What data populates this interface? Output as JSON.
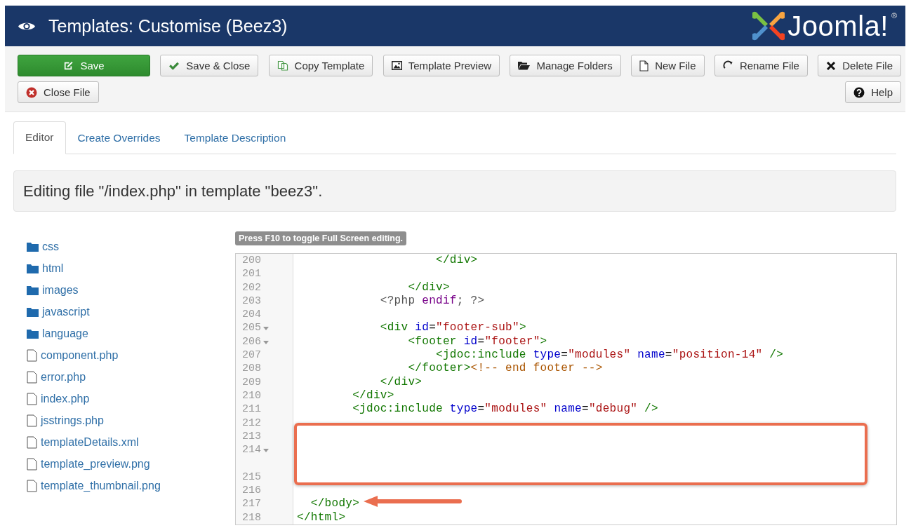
{
  "header": {
    "title": "Templates: Customise (Beez3)",
    "brand": "Joomla!",
    "brand_mark": "®"
  },
  "toolbar": {
    "buttons": [
      {
        "label": "Save",
        "kind": "save",
        "primary": true
      },
      {
        "label": "Save & Close",
        "kind": "apply",
        "primary": false
      },
      {
        "label": "Copy Template",
        "kind": "copy",
        "primary": false
      },
      {
        "label": "Template Preview",
        "kind": "preview",
        "primary": false
      },
      {
        "label": "Manage Folders",
        "kind": "folders",
        "primary": false
      },
      {
        "label": "New File",
        "kind": "new",
        "primary": false
      },
      {
        "label": "Rename File",
        "kind": "rename",
        "primary": false
      },
      {
        "label": "Delete File",
        "kind": "delete",
        "primary": false
      },
      {
        "label": "Close File",
        "kind": "close",
        "primary": false
      },
      {
        "label": "Help",
        "kind": "help",
        "primary": false
      }
    ]
  },
  "tabs": [
    {
      "label": "Editor",
      "selected": true
    },
    {
      "label": "Create Overrides",
      "selected": false
    },
    {
      "label": "Template Description",
      "selected": false
    }
  ],
  "editing_heading": "Editing file \"/index.php\" in template \"beez3\".",
  "files": [
    {
      "name": "css",
      "kind": "folder"
    },
    {
      "name": "html",
      "kind": "folder"
    },
    {
      "name": "images",
      "kind": "folder"
    },
    {
      "name": "javascript",
      "kind": "folder"
    },
    {
      "name": "language",
      "kind": "folder"
    },
    {
      "name": "component.php",
      "kind": "file"
    },
    {
      "name": "error.php",
      "kind": "file"
    },
    {
      "name": "index.php",
      "kind": "file"
    },
    {
      "name": "jsstrings.php",
      "kind": "file"
    },
    {
      "name": "templateDetails.xml",
      "kind": "file"
    },
    {
      "name": "template_preview.png",
      "kind": "file"
    },
    {
      "name": "template_thumbnail.png",
      "kind": "file"
    }
  ],
  "editor": {
    "hint": "Press F10 to toggle Full Screen editing.",
    "lines": [
      {
        "number": "200",
        "fold": false,
        "wrapped": false,
        "tokens": [
          {
            "kind": "tag",
            "text": "                    </div>"
          }
        ]
      },
      {
        "number": "201",
        "fold": false,
        "wrapped": false
      },
      {
        "number": "202",
        "fold": false,
        "wrapped": false,
        "tokens": [
          {
            "kind": "tag",
            "text": "                </div>"
          }
        ]
      },
      {
        "number": "203",
        "fold": false,
        "wrapped": false,
        "tokens": [
          {
            "kind": "meta",
            "text": "            <?php "
          },
          {
            "kind": "keyword",
            "text": "endif"
          },
          {
            "kind": "meta",
            "text": "; ?>"
          }
        ]
      },
      {
        "number": "204",
        "fold": false,
        "wrapped": false
      },
      {
        "number": "205",
        "fold": true,
        "wrapped": false,
        "tokens": [
          {
            "kind": "tag",
            "text": "            <div"
          },
          {
            "kind": "attr",
            "text": " id"
          },
          {
            "kind": "plain",
            "text": "="
          },
          {
            "kind": "string",
            "text": "\"footer-sub\""
          },
          {
            "kind": "tag",
            "text": ">"
          }
        ]
      },
      {
        "number": "206",
        "fold": true,
        "wrapped": false,
        "tokens": [
          {
            "kind": "tag",
            "text": "                <footer"
          },
          {
            "kind": "attr",
            "text": " id"
          },
          {
            "kind": "plain",
            "text": "="
          },
          {
            "kind": "string",
            "text": "\"footer\""
          },
          {
            "kind": "tag",
            "text": ">"
          }
        ]
      },
      {
        "number": "207",
        "fold": false,
        "wrapped": false,
        "tokens": [
          {
            "kind": "tag",
            "text": "                    <jdoc:include"
          },
          {
            "kind": "attr",
            "text": " type"
          },
          {
            "kind": "plain",
            "text": "="
          },
          {
            "kind": "string",
            "text": "\"modules\""
          },
          {
            "kind": "attr",
            "text": " name"
          },
          {
            "kind": "plain",
            "text": "="
          },
          {
            "kind": "string",
            "text": "\"position-14\""
          },
          {
            "kind": "tag",
            "text": " />"
          }
        ]
      },
      {
        "number": "208",
        "fold": false,
        "wrapped": false,
        "tokens": [
          {
            "kind": "tag",
            "text": "                </footer>"
          },
          {
            "kind": "comment",
            "text": "<!-- end footer -->"
          }
        ]
      },
      {
        "number": "209",
        "fold": false,
        "wrapped": false,
        "tokens": [
          {
            "kind": "tag",
            "text": "            </div>"
          }
        ]
      },
      {
        "number": "210",
        "fold": false,
        "wrapped": false,
        "tokens": [
          {
            "kind": "tag",
            "text": "        </div>"
          }
        ]
      },
      {
        "number": "211",
        "fold": false,
        "wrapped": false,
        "tokens": [
          {
            "kind": "tag",
            "text": "        <jdoc:include"
          },
          {
            "kind": "attr",
            "text": " type"
          },
          {
            "kind": "plain",
            "text": "="
          },
          {
            "kind": "string",
            "text": "\"modules\""
          },
          {
            "kind": "attr",
            "text": " name"
          },
          {
            "kind": "plain",
            "text": "="
          },
          {
            "kind": "string",
            "text": "\"debug\""
          },
          {
            "kind": "tag",
            "text": " />"
          }
        ]
      },
      {
        "number": "212",
        "fold": false,
        "wrapped": false
      },
      {
        "number": "213",
        "fold": false,
        "wrapped": false
      },
      {
        "number": "214",
        "fold": true,
        "wrapped": true
      },
      {
        "number": "215",
        "fold": false,
        "wrapped": false
      },
      {
        "number": "216",
        "fold": false,
        "wrapped": false
      },
      {
        "number": "217",
        "fold": false,
        "wrapped": false,
        "tokens": [
          {
            "kind": "tag",
            "text": "  </body>"
          }
        ]
      },
      {
        "number": "218",
        "fold": false,
        "wrapped": false,
        "tokens": [
          {
            "kind": "tag",
            "text": "</html>"
          }
        ]
      }
    ]
  }
}
